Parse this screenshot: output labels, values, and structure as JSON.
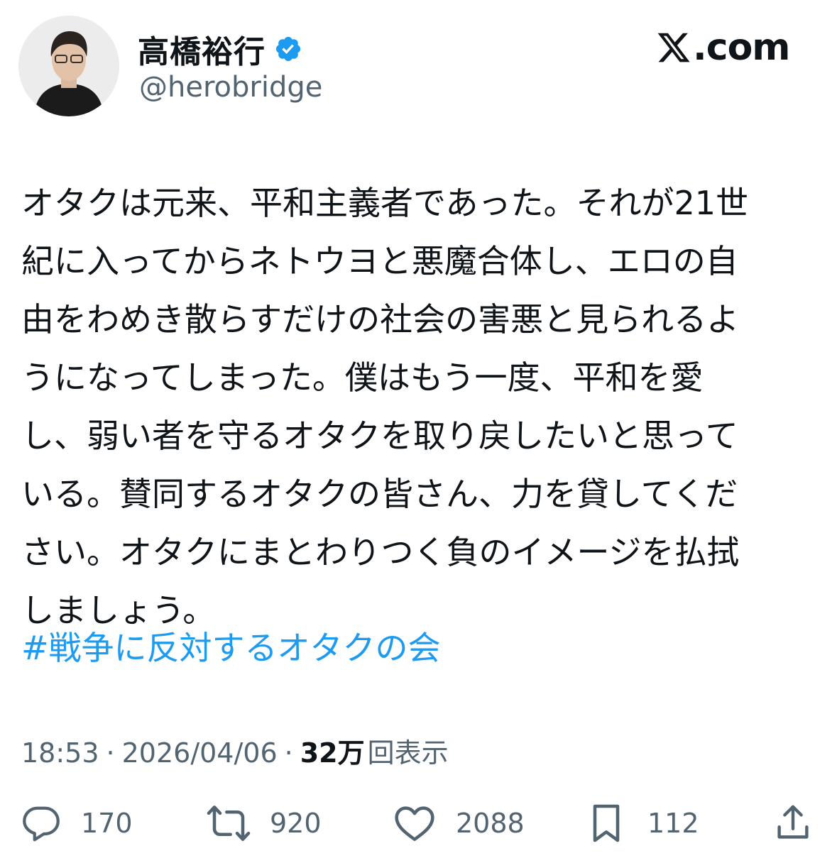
{
  "author": {
    "display_name": "高橋裕行",
    "handle": "@herobridge",
    "verified": true,
    "avatar_icon": "profile-photo"
  },
  "site": {
    "suffix": ".com",
    "logo_icon": "x-logo-icon"
  },
  "tweet": {
    "lines": [
      "オタクは元来、平和主義者であった。それが21世",
      "紀に入ってからネトウヨと悪魔合体し、エロの自",
      "由をわめき散らすだけの社会の害悪と見られるよ",
      "うになってしまった。僕はもう一度、平和を愛",
      "し、弱い者を守るオタクを取り戻したいと思って",
      "いる。賛同するオタクの皆さん、力を貸してくだ",
      "さい。オタクにまとわりつく負のイメージを払拭",
      "しましょう。"
    ],
    "hashtag": "#戦争に反対するオタクの会"
  },
  "meta": {
    "time": "18:53",
    "separator": "·",
    "date": "2026/04/06",
    "views_count": "32万",
    "views_label": "回表示"
  },
  "actions": {
    "reply": {
      "icon": "reply-icon",
      "count": "170"
    },
    "repost": {
      "icon": "repost-icon",
      "count": "920"
    },
    "like": {
      "icon": "like-icon",
      "count": "2088"
    },
    "bookmark": {
      "icon": "bookmark-icon",
      "count": "112"
    },
    "share": {
      "icon": "share-icon"
    }
  },
  "colors": {
    "text": "#0f1419",
    "secondary": "#536471",
    "link": "#1d9bf0",
    "verified_badge": "#1d9bf0"
  }
}
